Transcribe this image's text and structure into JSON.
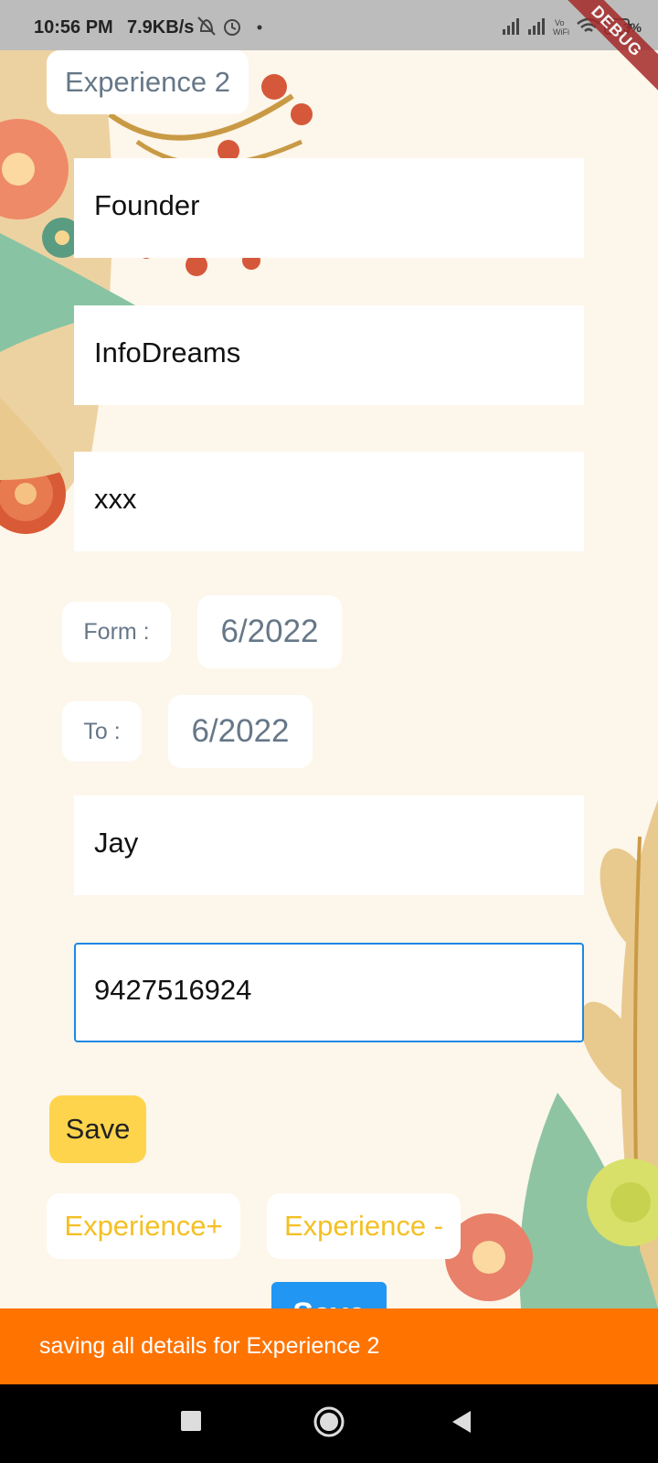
{
  "status_bar": {
    "time": "10:56 PM",
    "net_speed": "7.9KB/s",
    "battery": "3%",
    "debug_banner": "DEBUG"
  },
  "header": {
    "section_title": "Experience 2"
  },
  "form": {
    "designation_value": "Founder",
    "company_value": "InfoDreams",
    "description_value": "xxx",
    "from_label": "Form :",
    "from_value": "6/2022",
    "to_label": "To :",
    "to_value": "6/2022",
    "reference_name_value": "Jay",
    "reference_phone_value": "9427516924",
    "save_label": "Save"
  },
  "actions": {
    "add_experience_label": "Experience+",
    "remove_experience_label": "Experience -",
    "save_all_label": "Save"
  },
  "snackbar": {
    "message": "saving all details for  Experience 2"
  },
  "colors": {
    "background": "#fdf6ea",
    "snackbar": "#ff7300",
    "save_yellow": "#fdd44c",
    "experience_text": "#f4c025",
    "save_blue": "#2196f3",
    "focus_border": "#1e88e5"
  },
  "icons": [
    "notifications-off-icon",
    "alarm-icon",
    "signal-icon",
    "wifi-icon",
    "battery-icon",
    "recents-nav-icon",
    "home-nav-icon",
    "back-nav-icon"
  ]
}
